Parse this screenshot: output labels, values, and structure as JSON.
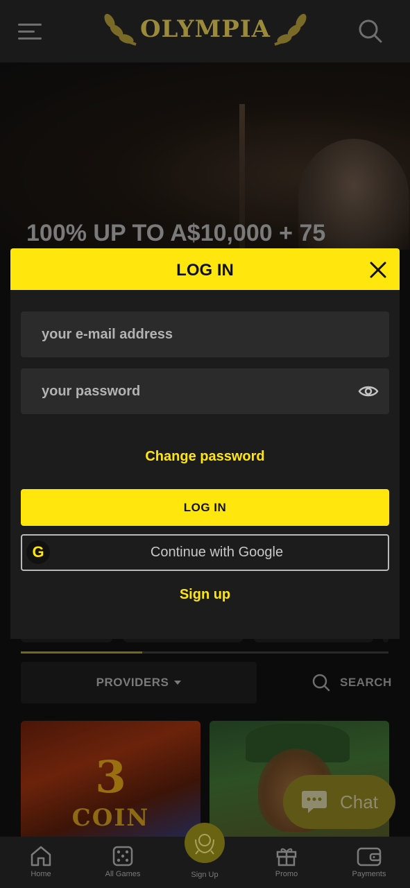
{
  "header": {
    "logo_text": "OLYMPIA",
    "icons": [
      "menu-icon",
      "laurel-icon",
      "search-icon"
    ]
  },
  "hero": {
    "title": "100% UP TO A$10,000 + 75"
  },
  "modal": {
    "title": "LOG IN",
    "email_placeholder": "your e-mail address",
    "password_placeholder": "your password",
    "change_password": "Change password",
    "login_button": "LOG IN",
    "google_button": "Continue with Google",
    "google_glyph": "G",
    "signup_link": "Sign up"
  },
  "filters": {
    "providers_label": "PROVIDERS",
    "search_label": "SEARCH",
    "scroll_progress": 0.33
  },
  "games": [
    {
      "name_line1": "3",
      "name_line2": "COIN"
    },
    {
      "name_line1": ""
    }
  ],
  "chat": {
    "label": "Chat"
  },
  "bottom_nav": {
    "items": [
      {
        "label": "Home",
        "icon": "home-icon"
      },
      {
        "label": "All Games",
        "icon": "dice-icon"
      },
      {
        "label": "Sign Up",
        "icon": "laurel-icon"
      },
      {
        "label": "Promo",
        "icon": "gift-icon"
      },
      {
        "label": "Payments",
        "icon": "wallet-icon"
      }
    ]
  },
  "colors": {
    "accent": "#ffe70e",
    "modal_bg": "#1c1c1c",
    "field_bg": "#2b2b2b",
    "page_bg": "#0e0e0e"
  }
}
